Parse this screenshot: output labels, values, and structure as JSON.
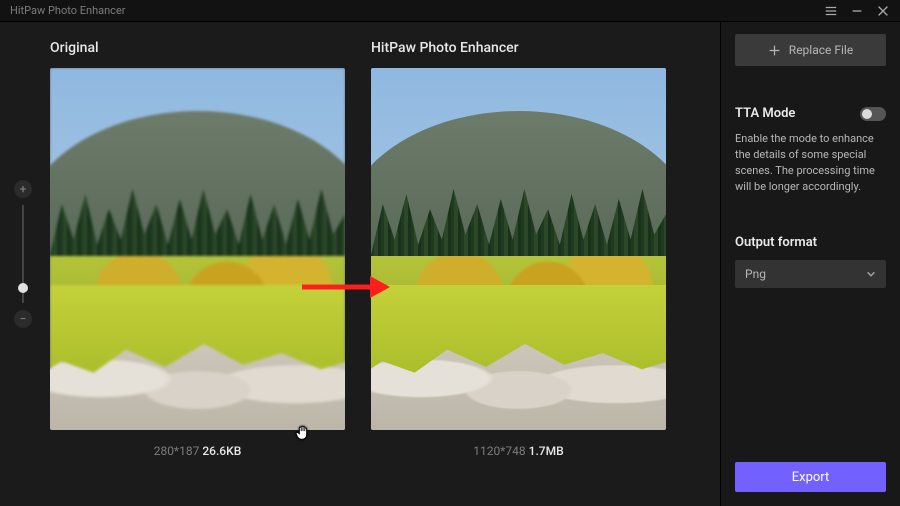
{
  "app": {
    "title": "HitPaw Photo Enhancer"
  },
  "main": {
    "original": {
      "heading": "Original",
      "dimensions": "280*187",
      "filesize": "26.6KB"
    },
    "enhanced": {
      "heading": "HitPaw Photo Enhancer",
      "dimensions": "1120*748",
      "filesize": "1.7MB"
    }
  },
  "sidebar": {
    "replace_label": "Replace File",
    "tta": {
      "label": "TTA Mode",
      "enabled": false,
      "description": "Enable the mode to enhance the details of some special scenes. The processing time will be longer accordingly."
    },
    "output_format": {
      "label": "Output format",
      "selected": "Png"
    },
    "export_label": "Export"
  }
}
